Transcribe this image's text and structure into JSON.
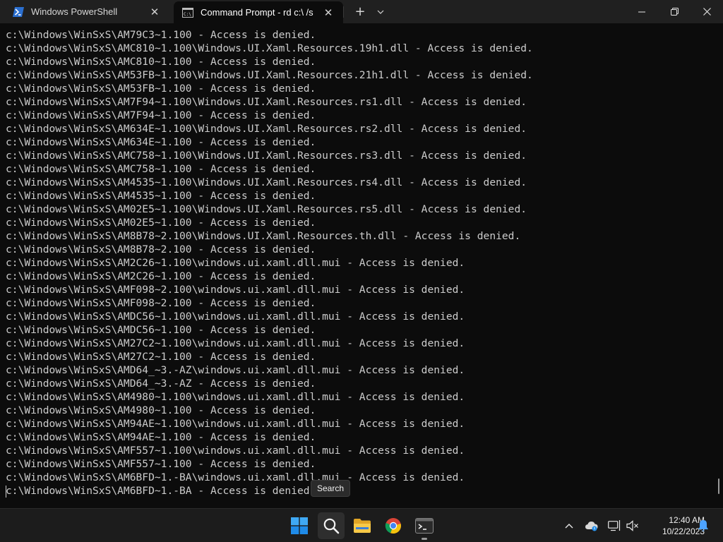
{
  "window": {
    "tabs": [
      {
        "label": "Windows PowerShell",
        "icon": "powershell-icon",
        "active": false
      },
      {
        "label": "Command Prompt - rd  c:\\ /s ",
        "icon": "cmd-icon",
        "active": true
      }
    ]
  },
  "console": {
    "lines": [
      "c:\\Windows\\WinSxS\\AM79C3~1.100 - Access is denied.",
      "c:\\Windows\\WinSxS\\AMC810~1.100\\Windows.UI.Xaml.Resources.19h1.dll - Access is denied.",
      "c:\\Windows\\WinSxS\\AMC810~1.100 - Access is denied.",
      "c:\\Windows\\WinSxS\\AM53FB~1.100\\Windows.UI.Xaml.Resources.21h1.dll - Access is denied.",
      "c:\\Windows\\WinSxS\\AM53FB~1.100 - Access is denied.",
      "c:\\Windows\\WinSxS\\AM7F94~1.100\\Windows.UI.Xaml.Resources.rs1.dll - Access is denied.",
      "c:\\Windows\\WinSxS\\AM7F94~1.100 - Access is denied.",
      "c:\\Windows\\WinSxS\\AM634E~1.100\\Windows.UI.Xaml.Resources.rs2.dll - Access is denied.",
      "c:\\Windows\\WinSxS\\AM634E~1.100 - Access is denied.",
      "c:\\Windows\\WinSxS\\AMC758~1.100\\Windows.UI.Xaml.Resources.rs3.dll - Access is denied.",
      "c:\\Windows\\WinSxS\\AMC758~1.100 - Access is denied.",
      "c:\\Windows\\WinSxS\\AM4535~1.100\\Windows.UI.Xaml.Resources.rs4.dll - Access is denied.",
      "c:\\Windows\\WinSxS\\AM4535~1.100 - Access is denied.",
      "c:\\Windows\\WinSxS\\AM02E5~1.100\\Windows.UI.Xaml.Resources.rs5.dll - Access is denied.",
      "c:\\Windows\\WinSxS\\AM02E5~1.100 - Access is denied.",
      "c:\\Windows\\WinSxS\\AM8B78~2.100\\Windows.UI.Xaml.Resources.th.dll - Access is denied.",
      "c:\\Windows\\WinSxS\\AM8B78~2.100 - Access is denied.",
      "c:\\Windows\\WinSxS\\AM2C26~1.100\\windows.ui.xaml.dll.mui - Access is denied.",
      "c:\\Windows\\WinSxS\\AM2C26~1.100 - Access is denied.",
      "c:\\Windows\\WinSxS\\AMF098~2.100\\windows.ui.xaml.dll.mui - Access is denied.",
      "c:\\Windows\\WinSxS\\AMF098~2.100 - Access is denied.",
      "c:\\Windows\\WinSxS\\AMDC56~1.100\\windows.ui.xaml.dll.mui - Access is denied.",
      "c:\\Windows\\WinSxS\\AMDC56~1.100 - Access is denied.",
      "c:\\Windows\\WinSxS\\AM27C2~1.100\\windows.ui.xaml.dll.mui - Access is denied.",
      "c:\\Windows\\WinSxS\\AM27C2~1.100 - Access is denied.",
      "c:\\Windows\\WinSxS\\AMD64_~3.-AZ\\windows.ui.xaml.dll.mui - Access is denied.",
      "c:\\Windows\\WinSxS\\AMD64_~3.-AZ - Access is denied.",
      "c:\\Windows\\WinSxS\\AM4980~1.100\\windows.ui.xaml.dll.mui - Access is denied.",
      "c:\\Windows\\WinSxS\\AM4980~1.100 - Access is denied.",
      "c:\\Windows\\WinSxS\\AM94AE~1.100\\windows.ui.xaml.dll.mui - Access is denied.",
      "c:\\Windows\\WinSxS\\AM94AE~1.100 - Access is denied.",
      "c:\\Windows\\WinSxS\\AMF557~1.100\\windows.ui.xaml.dll.mui - Access is denied.",
      "c:\\Windows\\WinSxS\\AMF557~1.100 - Access is denied.",
      "c:\\Windows\\WinSxS\\AM6BFD~1.-BA\\windows.ui.xaml.dll.mui - Access is denied.",
      "c:\\Windows\\WinSxS\\AM6BFD~1.-BA - Access is denied."
    ],
    "text_color": "#cccccc",
    "background": "#0c0c0c"
  },
  "tooltip": {
    "text": "Search"
  },
  "taskbar": {
    "apps": [
      {
        "name": "start-button",
        "icon": "windows-logo-icon"
      },
      {
        "name": "search-button",
        "icon": "search-icon"
      },
      {
        "name": "file-explorer-button",
        "icon": "folder-icon"
      },
      {
        "name": "chrome-button",
        "icon": "chrome-icon"
      },
      {
        "name": "terminal-button",
        "icon": "terminal-icon"
      }
    ],
    "clock": {
      "time": "12:40 AM",
      "date": "10/22/2023"
    }
  }
}
